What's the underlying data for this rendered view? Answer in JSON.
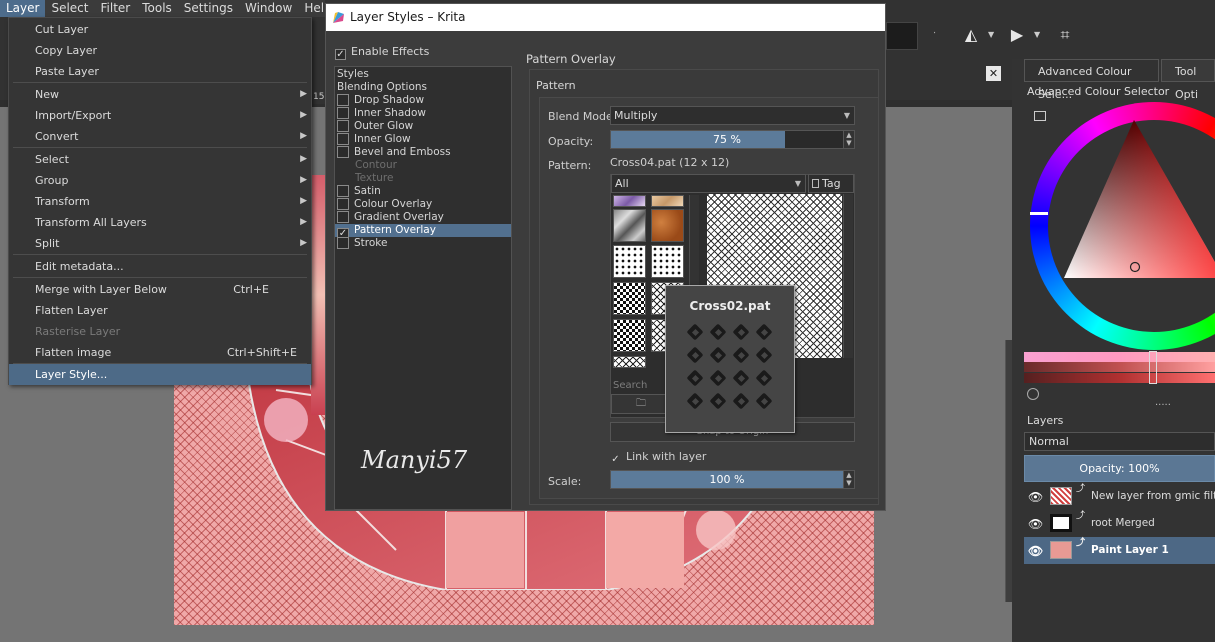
{
  "menubar": {
    "items": [
      {
        "label": "Layer"
      },
      {
        "label": "Select"
      },
      {
        "label": "Filter"
      },
      {
        "label": "Tools"
      },
      {
        "label": "Settings"
      },
      {
        "label": "Window"
      },
      {
        "label": "Help"
      }
    ]
  },
  "layer_menu": {
    "items": [
      {
        "label": "Cut Layer",
        "shortcut": "",
        "submenu": false,
        "enabled": true
      },
      {
        "label": "Copy Layer",
        "shortcut": "",
        "submenu": false,
        "enabled": true
      },
      {
        "label": "Paste Layer",
        "shortcut": "",
        "submenu": false,
        "enabled": true
      },
      {
        "label": "New",
        "shortcut": "",
        "submenu": true,
        "enabled": true
      },
      {
        "label": "Import/Export",
        "shortcut": "",
        "submenu": true,
        "enabled": true
      },
      {
        "label": "Convert",
        "shortcut": "",
        "submenu": true,
        "enabled": true
      },
      {
        "label": "Select",
        "shortcut": "",
        "submenu": true,
        "enabled": true
      },
      {
        "label": "Group",
        "shortcut": "",
        "submenu": true,
        "enabled": true
      },
      {
        "label": "Transform",
        "shortcut": "",
        "submenu": true,
        "enabled": true
      },
      {
        "label": "Transform All Layers",
        "shortcut": "",
        "submenu": true,
        "enabled": true
      },
      {
        "label": "Split",
        "shortcut": "",
        "submenu": true,
        "enabled": true
      },
      {
        "label": "Edit metadata...",
        "shortcut": "",
        "submenu": false,
        "enabled": true
      },
      {
        "label": "Merge with Layer Below",
        "shortcut": "Ctrl+E",
        "submenu": false,
        "enabled": true
      },
      {
        "label": "Flatten Layer",
        "shortcut": "",
        "submenu": false,
        "enabled": true
      },
      {
        "label": "Rasterise Layer",
        "shortcut": "",
        "submenu": false,
        "enabled": false
      },
      {
        "label": "Flatten image",
        "shortcut": "Ctrl+Shift+E",
        "submenu": false,
        "enabled": true
      },
      {
        "label": "Layer Style...",
        "shortcut": "",
        "submenu": false,
        "enabled": true,
        "selected": true
      }
    ]
  },
  "ruler_number": "15",
  "dialog": {
    "title": "Layer Styles – Krita",
    "enable_effects": "Enable Effects",
    "styles": [
      {
        "label": "Styles",
        "checkbox": false
      },
      {
        "label": "Blending Options",
        "checkbox": false
      },
      {
        "label": "Drop Shadow",
        "checkbox": true,
        "checked": false
      },
      {
        "label": "Inner Shadow",
        "checkbox": true,
        "checked": false
      },
      {
        "label": "Outer Glow",
        "checkbox": true,
        "checked": false
      },
      {
        "label": "Inner Glow",
        "checkbox": true,
        "checked": false
      },
      {
        "label": "Bevel and Emboss",
        "checkbox": true,
        "checked": false
      },
      {
        "label": "Contour",
        "checkbox": false,
        "sub": true
      },
      {
        "label": "Texture",
        "checkbox": false,
        "sub": true
      },
      {
        "label": "Satin",
        "checkbox": true,
        "checked": false
      },
      {
        "label": "Colour Overlay",
        "checkbox": true,
        "checked": false
      },
      {
        "label": "Gradient Overlay",
        "checkbox": true,
        "checked": false
      },
      {
        "label": "Pattern Overlay",
        "checkbox": true,
        "checked": true,
        "selected": true
      },
      {
        "label": "Stroke",
        "checkbox": true,
        "checked": false
      }
    ],
    "signature": "Manyi57",
    "panel_title": "Pattern Overlay",
    "group_title": "Pattern",
    "blend_mode_label": "Blend Mode:",
    "blend_mode_value": "Multiply",
    "opacity_label": "Opacity:",
    "opacity_value": "75 %",
    "opacity_fraction": 0.75,
    "pattern_label": "Pattern:",
    "pattern_name": "Cross04.pat (12 x 12)",
    "tag_filter": "All",
    "tag_button": "Tag",
    "search_placeholder": "Search",
    "snap_button": "Snap to Origin",
    "link_label": "Link with layer",
    "scale_label": "Scale:",
    "scale_value": "100 %",
    "scale_fraction": 1.0,
    "tooltip_title": "Cross02.pat"
  },
  "right_dock": {
    "tabs": [
      {
        "label": "Advanced Colour Sele..."
      },
      {
        "label": "Tool Opti"
      }
    ],
    "color_selector_title": "Advanced Colour Selector",
    "layers_title": "Layers",
    "blend_mode": "Normal",
    "opacity": "Opacity:  100%",
    "layers": [
      {
        "name": "New layer from gmic filter",
        "active": false
      },
      {
        "name": "root Merged",
        "active": false
      },
      {
        "name": "Paint Layer 1",
        "active": true
      }
    ],
    "dots": "....."
  },
  "colors": {
    "accent": "#4d6c8c",
    "canvas_pink": "#f0a8a8",
    "dialog_bg": "#3c3c3c"
  }
}
